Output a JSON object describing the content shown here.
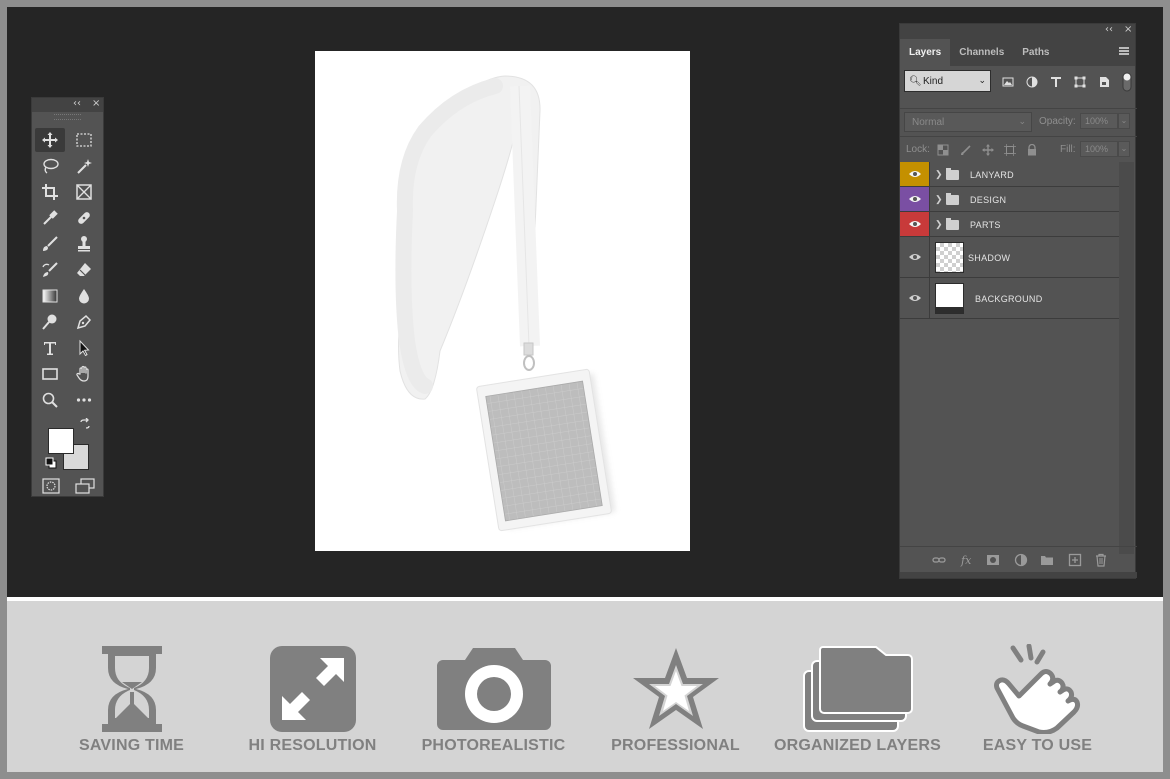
{
  "tools_panel": {
    "collapse_glyph": "‹‹",
    "close_glyph": "×",
    "tools": [
      {
        "name": "move-tool",
        "icon": "move-icon",
        "active": true
      },
      {
        "name": "marquee-tool",
        "icon": "marquee-icon"
      },
      {
        "name": "lasso-tool",
        "icon": "lasso-icon"
      },
      {
        "name": "magic-wand-tool",
        "icon": "magic-wand-icon"
      },
      {
        "name": "crop-tool",
        "icon": "crop-icon"
      },
      {
        "name": "frame-tool",
        "icon": "frame-icon"
      },
      {
        "name": "eyedropper-tool",
        "icon": "eyedropper-icon"
      },
      {
        "name": "healing-tool",
        "icon": "bandage-icon"
      },
      {
        "name": "brush-tool",
        "icon": "brush-icon"
      },
      {
        "name": "stamp-tool",
        "icon": "stamp-icon"
      },
      {
        "name": "history-brush-tool",
        "icon": "history-brush-icon"
      },
      {
        "name": "eraser-tool",
        "icon": "eraser-icon"
      },
      {
        "name": "gradient-tool",
        "icon": "gradient-icon"
      },
      {
        "name": "blur-tool",
        "icon": "drop-icon"
      },
      {
        "name": "dodge-tool",
        "icon": "dodge-icon"
      },
      {
        "name": "pen-tool",
        "icon": "pen-icon"
      },
      {
        "name": "type-tool",
        "icon": "type-icon"
      },
      {
        "name": "path-selection-tool",
        "icon": "arrow-icon"
      },
      {
        "name": "rectangle-tool",
        "icon": "rectangle-icon"
      },
      {
        "name": "hand-tool",
        "icon": "hand-icon"
      },
      {
        "name": "zoom-tool",
        "icon": "zoom-icon"
      },
      {
        "name": "more-tools",
        "icon": "ellipsis-icon"
      }
    ],
    "foreground_color": "#ffffff",
    "background_color": "#d9d9d9"
  },
  "layers_panel": {
    "collapse_glyph": "‹‹",
    "close_glyph": "×",
    "tabs": [
      "Layers",
      "Channels",
      "Paths"
    ],
    "active_tab": "Layers",
    "filter_kind": "Kind",
    "blend_mode": "Normal",
    "opacity_label": "Opacity:",
    "opacity_value": "100%",
    "lock_label": "Lock:",
    "fill_label": "Fill:",
    "fill_value": "100%",
    "layers": [
      {
        "name": "LANYARD",
        "type": "group",
        "color": "#c49000"
      },
      {
        "name": "DESIGN",
        "type": "group",
        "color": "#7a4fa3"
      },
      {
        "name": "PARTS",
        "type": "group",
        "color": "#c83a3a"
      },
      {
        "name": "SHADOW",
        "type": "layer",
        "thumb": "transparent"
      },
      {
        "name": "BACKGROUND",
        "type": "layer",
        "thumb": "white"
      }
    ]
  },
  "features": [
    {
      "label": "SAVING TIME",
      "icon": "hourglass-icon"
    },
    {
      "label": "HI RESOLUTION",
      "icon": "expand-icon"
    },
    {
      "label": "PHOTOREALISTIC",
      "icon": "camera-icon"
    },
    {
      "label": "PROFESSIONAL",
      "icon": "star-icon"
    },
    {
      "label": "ORGANIZED LAYERS",
      "icon": "folders-icon"
    },
    {
      "label": "EASY TO USE",
      "icon": "tap-hand-icon"
    }
  ]
}
